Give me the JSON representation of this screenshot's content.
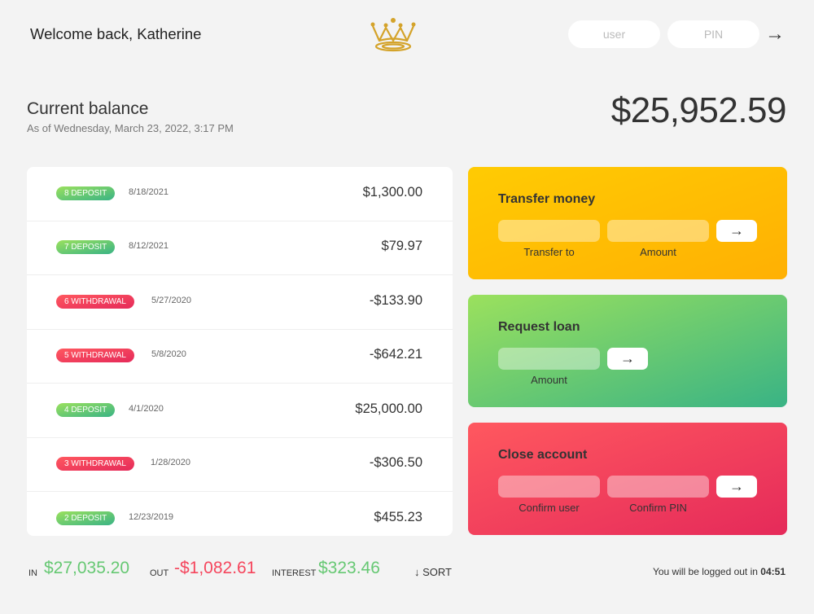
{
  "nav": {
    "welcome": "Welcome back, Katherine",
    "user_placeholder": "user",
    "pin_placeholder": "PIN",
    "login_arrow": "→",
    "logo_color": "#d4a32a"
  },
  "balance": {
    "label": "Current balance",
    "date": "As of Wednesday, March 23, 2022, 3:17 PM",
    "value": "$25,952.59"
  },
  "movements": [
    {
      "type": "8 DEPOSIT",
      "kind": "deposit",
      "date": "8/18/2021",
      "value": "$1,300.00"
    },
    {
      "type": "7 DEPOSIT",
      "kind": "deposit",
      "date": "8/12/2021",
      "value": "$79.97"
    },
    {
      "type": "6 WITHDRAWAL",
      "kind": "withdrawal",
      "date": "5/27/2020",
      "value": "-$133.90"
    },
    {
      "type": "5 WITHDRAWAL",
      "kind": "withdrawal",
      "date": "5/8/2020",
      "value": "-$642.21"
    },
    {
      "type": "4 DEPOSIT",
      "kind": "deposit",
      "date": "4/1/2020",
      "value": "$25,000.00"
    },
    {
      "type": "3 WITHDRAWAL",
      "kind": "withdrawal",
      "date": "1/28/2020",
      "value": "-$306.50"
    },
    {
      "type": "2 DEPOSIT",
      "kind": "deposit",
      "date": "12/23/2019",
      "value": "$455.23"
    }
  ],
  "operations": {
    "transfer": {
      "title": "Transfer money",
      "label_to": "Transfer to",
      "label_amount": "Amount",
      "button": "→"
    },
    "loan": {
      "title": "Request loan",
      "label_amount": "Amount",
      "button": "→"
    },
    "close": {
      "title": "Close account",
      "label_user": "Confirm user",
      "label_pin": "Confirm PIN",
      "button": "→"
    }
  },
  "summary": {
    "in_label": "In",
    "in_value": "$27,035.20",
    "out_label": "Out",
    "out_value": "-$1,082.61",
    "interest_label": "Interest",
    "interest_value": "$323.46",
    "sort": "↓ SORT"
  },
  "logout": {
    "text": "You will be logged out in",
    "timer": "04:51"
  }
}
